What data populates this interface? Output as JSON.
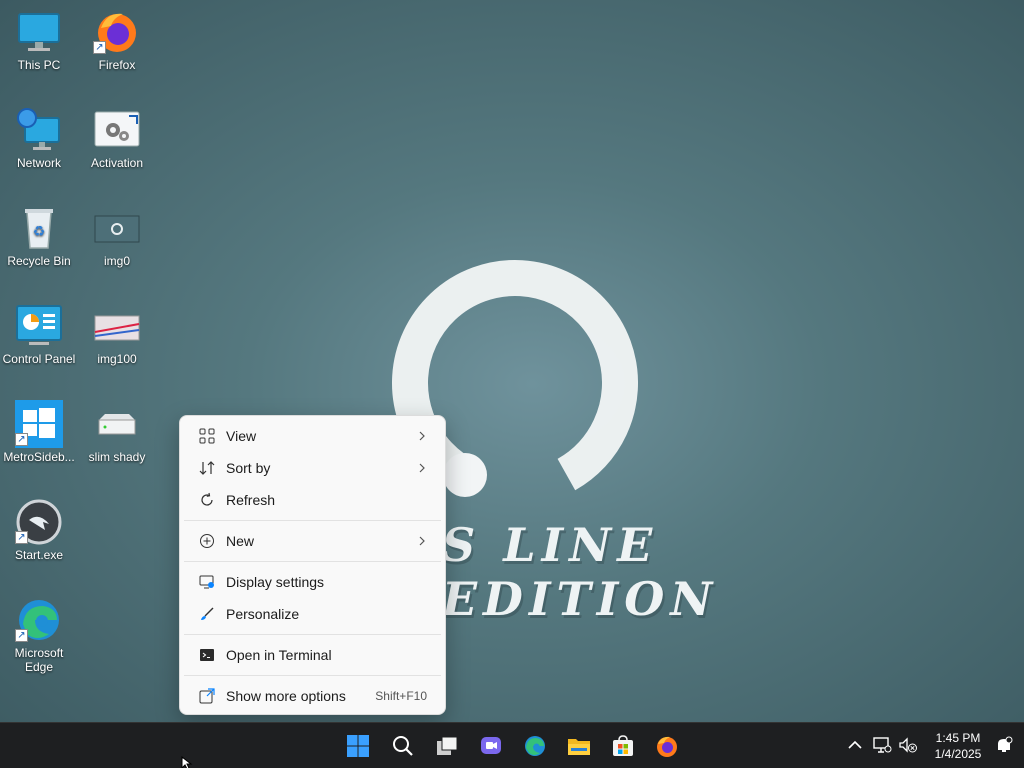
{
  "desktop": {
    "icons": [
      {
        "label": "This PC"
      },
      {
        "label": "Firefox"
      },
      {
        "label": "Network"
      },
      {
        "label": "Activation"
      },
      {
        "label": "Recycle Bin"
      },
      {
        "label": "img0"
      },
      {
        "label": "Control Panel"
      },
      {
        "label": "img100"
      },
      {
        "label": "MetroSideb..."
      },
      {
        "label": "slim shady"
      },
      {
        "label": "Start.exe"
      },
      {
        "label": "Microsoft Edge"
      }
    ]
  },
  "wallpaper": {
    "text": "S LINE EDITION"
  },
  "context_menu": {
    "items": [
      {
        "label": "View",
        "icon": "view-grid-icon",
        "submenu": true
      },
      {
        "label": "Sort by",
        "icon": "sort-icon",
        "submenu": true
      },
      {
        "label": "Refresh",
        "icon": "refresh-icon"
      },
      {
        "label": "New",
        "icon": "new-plus-icon",
        "submenu": true
      },
      {
        "label": "Display settings",
        "icon": "display-settings-icon"
      },
      {
        "label": "Personalize",
        "icon": "brush-icon"
      },
      {
        "label": "Open in Terminal",
        "icon": "terminal-icon"
      },
      {
        "label": "Show more options",
        "icon": "more-options-icon",
        "accelerator": "Shift+F10"
      }
    ]
  },
  "taskbar": {
    "apps": [
      "start-button",
      "search-button",
      "task-view-button",
      "chat-button",
      "edge-button",
      "file-explorer-button",
      "store-button",
      "firefox-button"
    ],
    "clock": {
      "time": "1:45 PM",
      "date": "1/4/2025"
    }
  },
  "colors": {
    "taskbar_bg": "#1e1f21",
    "menu_bg": "#f9f9f9",
    "accent_blue": "#0a84ff"
  }
}
